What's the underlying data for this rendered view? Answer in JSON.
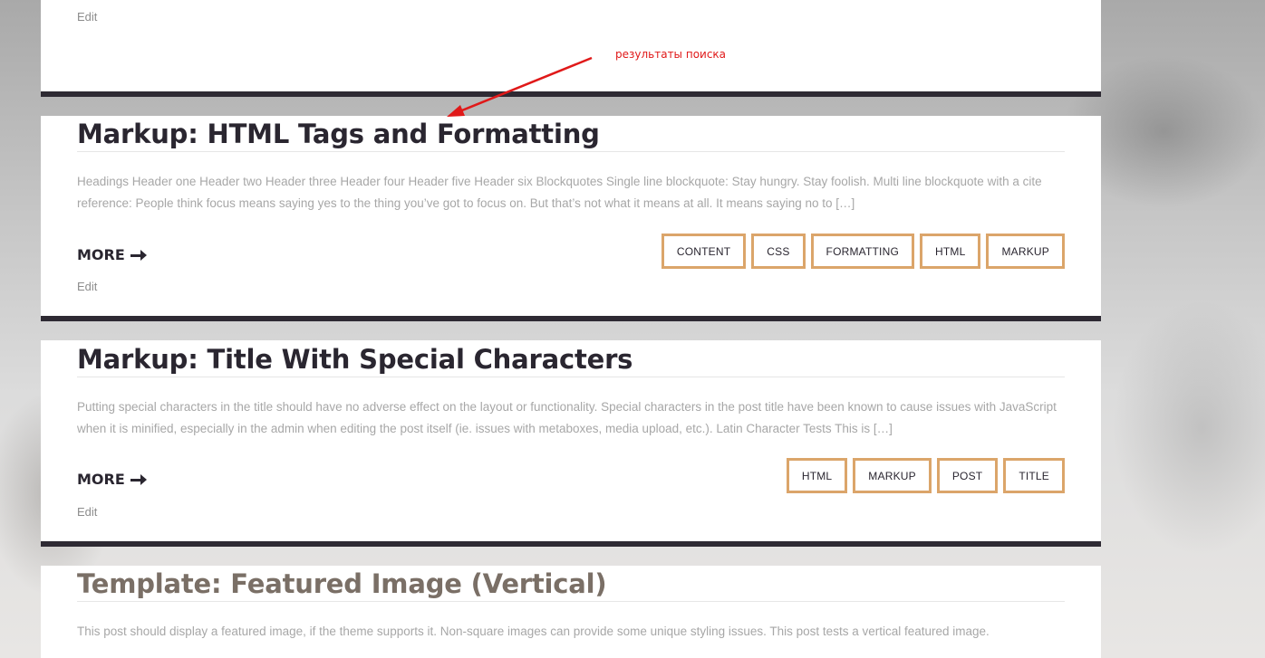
{
  "annotation": {
    "text": "результаты поиска",
    "color": "#e01919"
  },
  "top_card": {
    "edit_label": "Edit"
  },
  "posts": [
    {
      "title": "Markup: HTML Tags and Formatting",
      "excerpt": "Headings Header one Header two Header three Header four Header five Header six Blockquotes Single line blockquote: Stay hungry. Stay foolish. Multi line blockquote with a cite reference: People think focus means saying yes to the thing you’ve got to focus on. But that’s not what it means at all. It means saying no to […]",
      "more_label": "MORE",
      "edit_label": "Edit",
      "tags": [
        "CONTENT",
        "CSS",
        "FORMATTING",
        "HTML",
        "MARKUP"
      ]
    },
    {
      "title": "Markup: Title With Special Characters",
      "excerpt": "Putting special characters in the title should have no adverse effect on the layout or functionality. Special characters in the post title have been known to cause issues with JavaScript when it is minified, especially in the admin when editing the post itself (ie. issues with metaboxes, media upload, etc.). Latin Character Tests This is […]",
      "more_label": "MORE",
      "edit_label": "Edit",
      "tags": [
        "HTML",
        "MARKUP",
        "POST",
        "TITLE"
      ]
    },
    {
      "title": "Template: Featured Image (Vertical)",
      "excerpt": "This post should display a featured image, if the theme supports it. Non-square images can provide some unique styling issues. This post tests a vertical featured image."
    }
  ],
  "colors": {
    "tag_border": "#dba56a",
    "card_separator": "#2e2a33",
    "title": "#2a2630",
    "excerpt": "#a7a7a7"
  }
}
